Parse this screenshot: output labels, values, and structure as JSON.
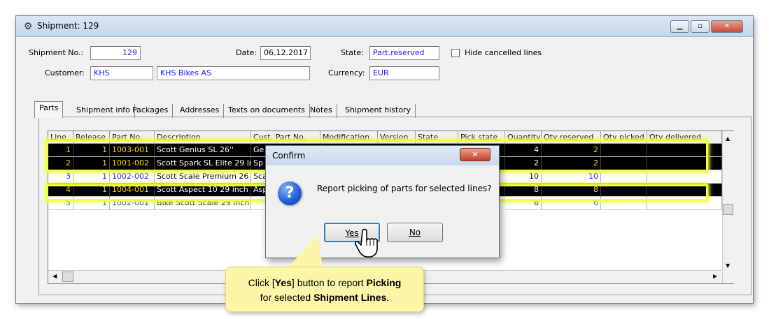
{
  "window": {
    "title": "Shipment: 129",
    "icon": "settings-app-icon"
  },
  "header": {
    "shipment_no_label": "Shipment No.:",
    "shipment_no": "129",
    "date_label": "Date:",
    "date": "06.12.2017",
    "state_label": "State:",
    "state": "Part.reserved",
    "hide_cancelled_label": "Hide cancelled lines",
    "customer_label": "Customer:",
    "customer_code": "KHS",
    "customer_name": "KHS Bikes AS",
    "currency_label": "Currency:",
    "currency": "EUR"
  },
  "tabs": [
    "Parts",
    "Shipment info",
    "Packages",
    "Addresses",
    "Texts on documents",
    "Notes",
    "Shipment history"
  ],
  "table": {
    "columns": [
      "Line",
      "Release",
      "Part No.",
      "Description",
      "Cust. Part No.",
      "Modification",
      "Version",
      "State",
      "Pick state",
      "Quantity",
      "Qty reserved",
      "Qty picked",
      "Qty delivered"
    ],
    "rows": [
      {
        "line": "1",
        "release": "1",
        "part_no": "1003-001",
        "description": "Scott Genius SL 26''",
        "cust_part": "Ge",
        "quantity": "4",
        "qty_reserved": "2",
        "selected": true
      },
      {
        "line": "2",
        "release": "1",
        "part_no": "1001-002",
        "description": "Scott Spark SL Elite 29 inch",
        "cust_part": "Sp",
        "quantity": "2",
        "qty_reserved": "2",
        "selected": true
      },
      {
        "line": "3",
        "release": "1",
        "part_no": "1002-002",
        "description": "Scott Scale Premium 26 inch",
        "cust_part": "Sca",
        "quantity": "10",
        "qty_reserved": "10",
        "selected": false
      },
      {
        "line": "4",
        "release": "1",
        "part_no": "1004-001",
        "description": "Scott Aspect 10 29 inch",
        "cust_part": "Asp",
        "quantity": "8",
        "qty_reserved": "8",
        "selected": true
      },
      {
        "line": "5",
        "release": "1",
        "part_no": "1002-001",
        "description": "Bike Scott Scale 29 inch",
        "cust_part": "",
        "quantity": "6",
        "qty_reserved": "6",
        "selected": false
      }
    ]
  },
  "dialog": {
    "title": "Confirm",
    "message": "Report picking of parts for selected lines?",
    "yes_label": "Yes",
    "no_label": "No"
  },
  "tooltip": {
    "line1_pre": "Click [",
    "line1_bold": "Yes",
    "line1_mid": "] button to report ",
    "line1_bold2": "Picking",
    "line2_pre": "for selected ",
    "line2_bold": "Shipment Lines",
    "line2_post": "."
  }
}
